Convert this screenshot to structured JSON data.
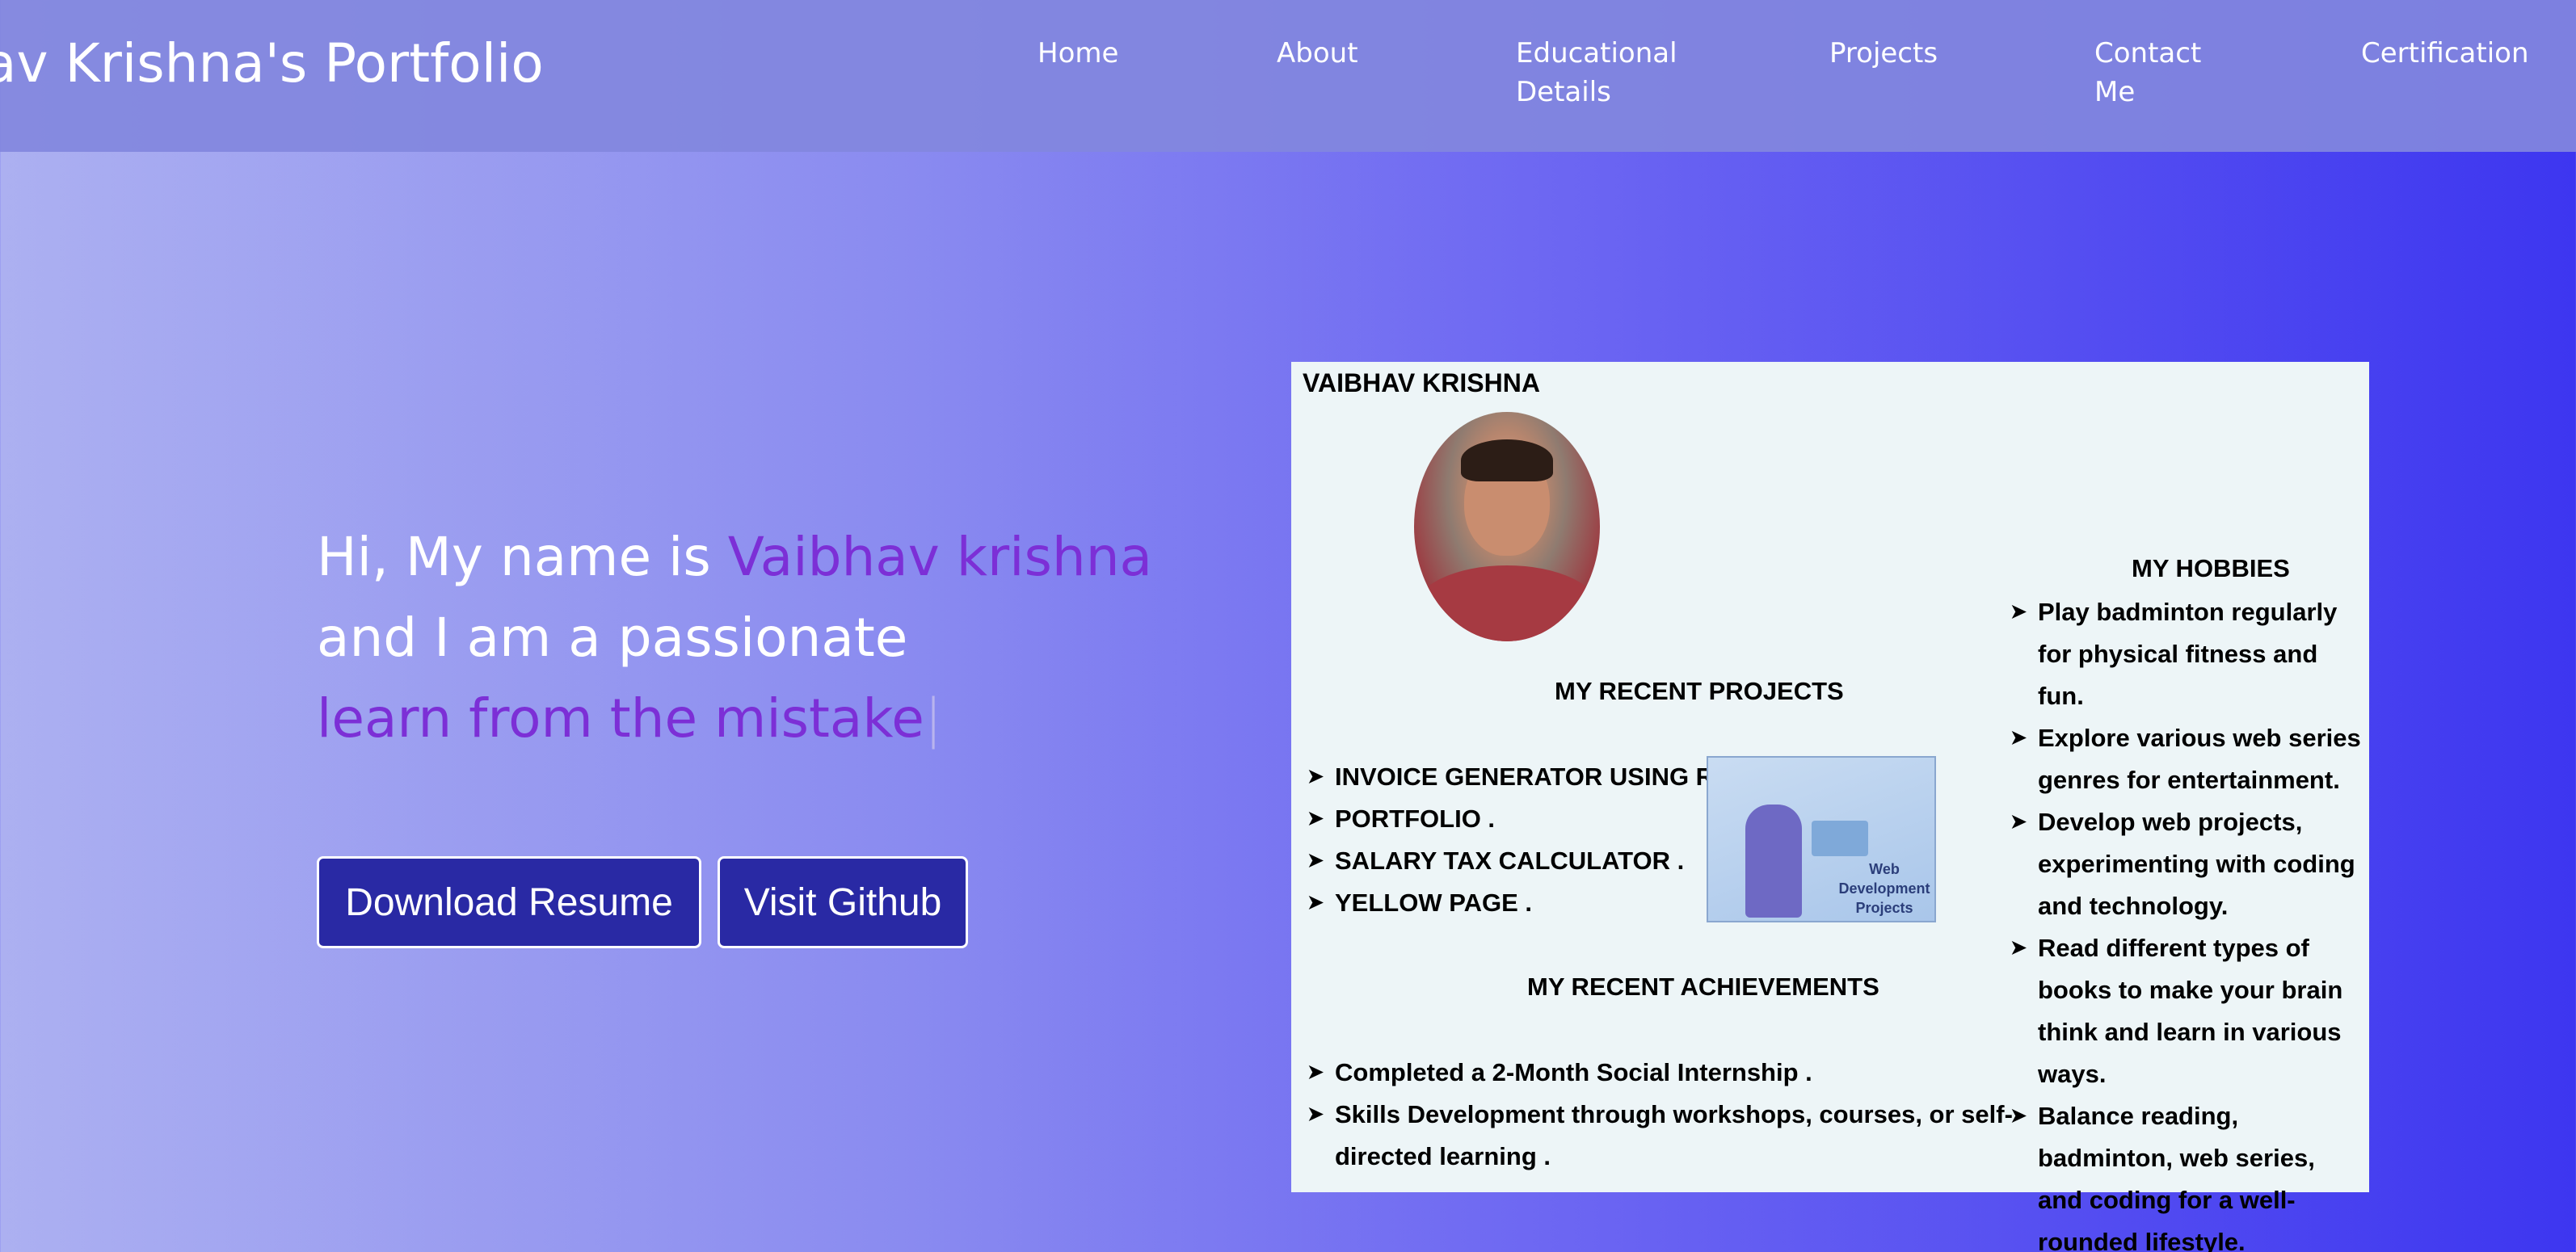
{
  "header": {
    "brand": "av Krishna's Portfolio",
    "nav": [
      {
        "label": "Home"
      },
      {
        "label": "About"
      },
      {
        "label": "Educational Details"
      },
      {
        "label": "Projects"
      },
      {
        "label": "Contact Me"
      },
      {
        "label": "Certification"
      }
    ]
  },
  "hero": {
    "intro": "Hi, My name is ",
    "name": "Vaibhav krishna",
    "line2": "and I am a passionate",
    "typed": "learn from the mistake",
    "cursor": "|"
  },
  "buttons": {
    "resume": "Download Resume",
    "github": "Visit Github"
  },
  "card": {
    "name": "VAIBHAV KRISHNA",
    "projects_title": "MY  RECENT PROJECTS",
    "projects": [
      "INVOICE GENERATOR USING REACT.",
      "PORTFOLIO .",
      "SALARY TAX CALCULATOR .",
      "YELLOW PAGE ."
    ],
    "project_image_label": "Web Development Projects",
    "achievements_title": "MY RECENT ACHIEVEMENTS",
    "achievements": [
      "Completed a 2-Month Social Internship .",
      "Skills Development through workshops, courses, or self-directed learning ."
    ],
    "hobbies_title": "MY HOBBIES",
    "hobbies": [
      "Play badminton regularly for physical fitness and fun.",
      "Explore various web series genres for entertainment.",
      "Develop web projects, experimenting with coding and technology.",
      "Read different types of books to make your brain think and learn in various ways.",
      "Balance reading, badminton, web series, and coding for a well-rounded lifestyle."
    ]
  },
  "colors": {
    "accent": "#7c2fd6",
    "button": "#2929a4",
    "navbar": "#8287de"
  }
}
